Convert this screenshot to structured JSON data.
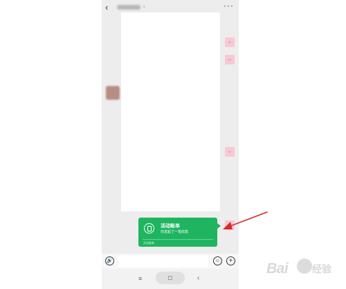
{
  "header": {
    "back_icon": "chevron-left-icon",
    "title_mark": "♀",
    "more_icon": "more-icon",
    "more_glyph": "···"
  },
  "messages": {
    "right_avatar_glyph": "ᴗ"
  },
  "bubble": {
    "title": "活动账单",
    "subtitle": "你发起了一笔收款",
    "footer": "活动账单"
  },
  "inputbar": {
    "voice_icon": "voice-icon",
    "voice_glyph": "🔊",
    "emoji_icon": "emoji-icon",
    "emoji_glyph": "☺",
    "plus_icon": "plus-icon",
    "plus_glyph": "+"
  },
  "navbar": {
    "menu_glyph": "≡",
    "home_glyph": "◻",
    "back_glyph": "‹"
  },
  "watermark": {
    "brand": "Bai",
    "suffix": "经验"
  },
  "colors": {
    "bubble_green": "#1fb560",
    "chat_bg": "#ededed",
    "arrow_red": "#d62c2c",
    "avatar_pink": "#f6c9d4"
  }
}
